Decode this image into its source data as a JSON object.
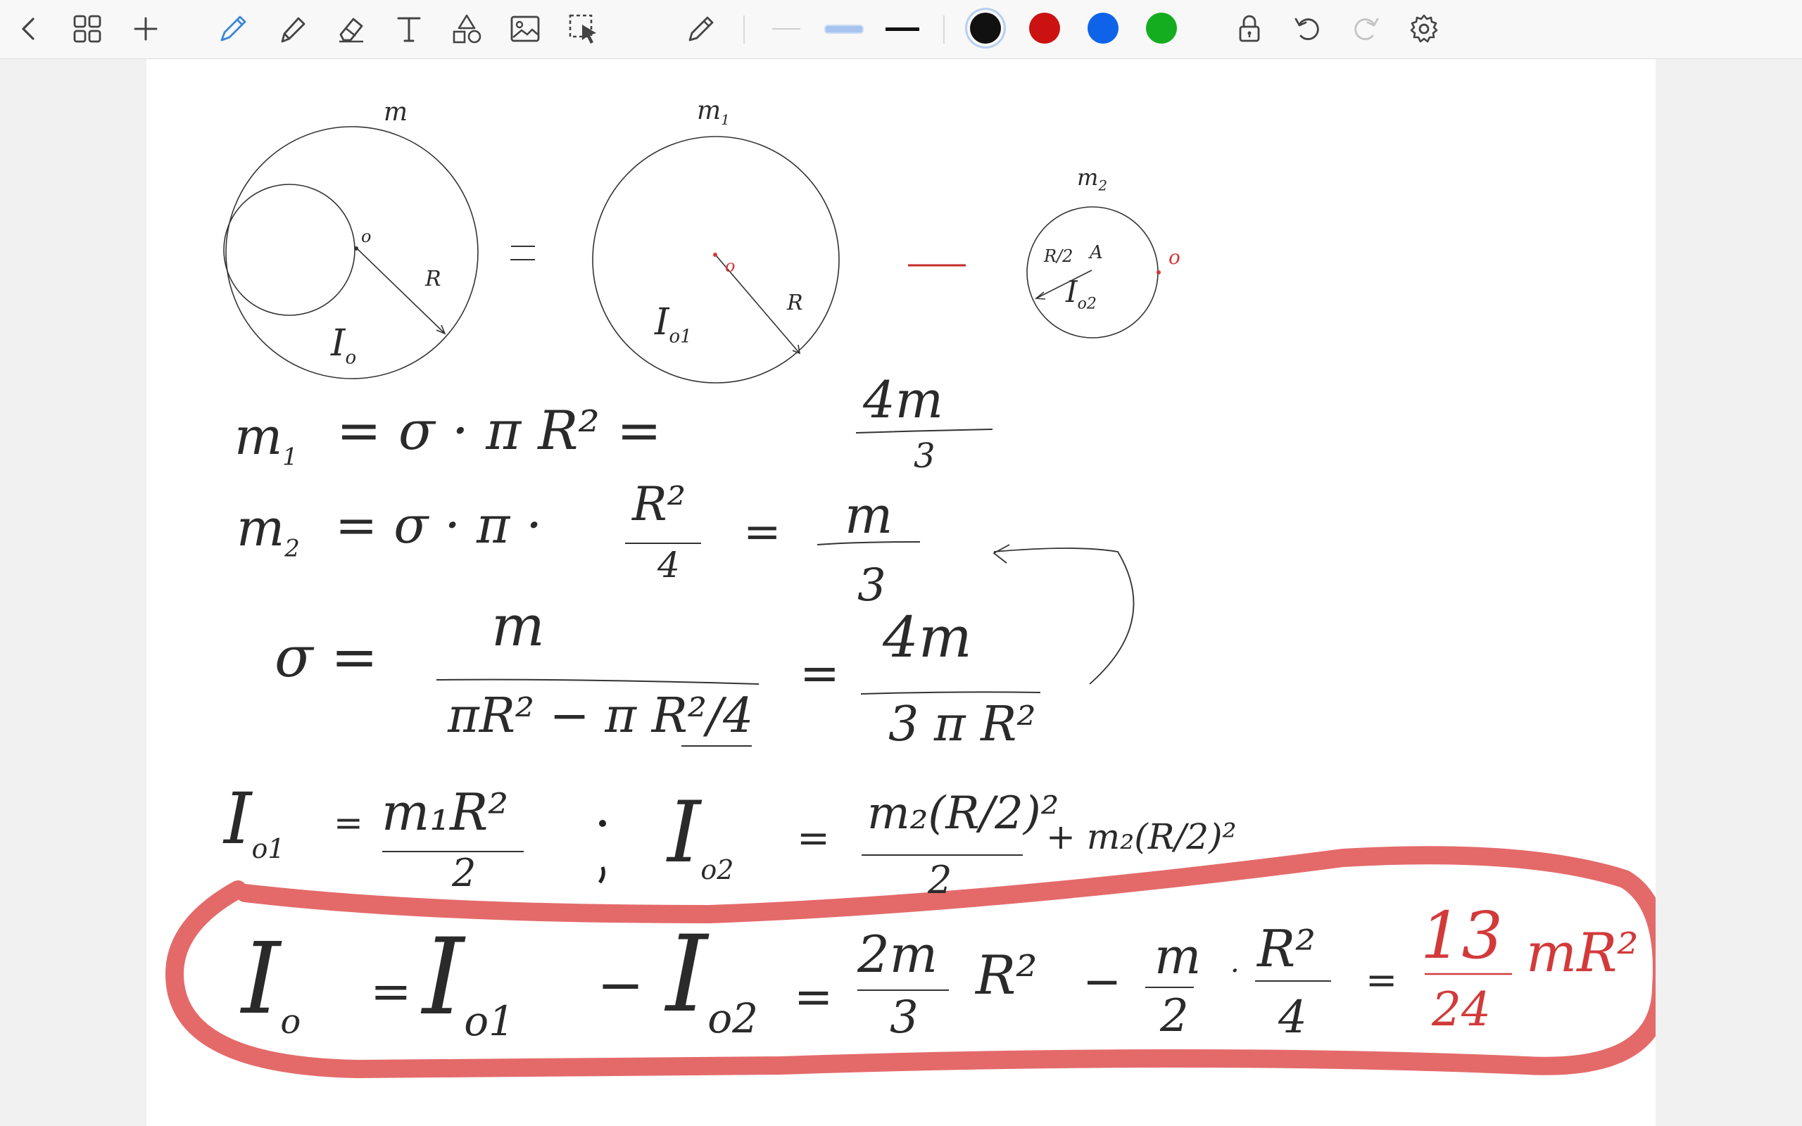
{
  "toolbar": {
    "tools": [
      {
        "id": "back",
        "icon": "chevron-left-icon"
      },
      {
        "id": "pages",
        "icon": "grid-icon"
      },
      {
        "id": "add",
        "icon": "plus-icon"
      },
      {
        "id": "pen",
        "icon": "pen-icon",
        "active": true
      },
      {
        "id": "highlighter",
        "icon": "highlighter-icon"
      },
      {
        "id": "eraser",
        "icon": "eraser-icon"
      },
      {
        "id": "text",
        "icon": "text-icon",
        "glyph": "T"
      },
      {
        "id": "shapes",
        "icon": "shapes-icon"
      },
      {
        "id": "image",
        "icon": "image-icon"
      },
      {
        "id": "lasso",
        "icon": "lasso-select-icon"
      },
      {
        "id": "pencil",
        "icon": "pencil-icon"
      }
    ],
    "stroke_widths": [
      "thin",
      "medium",
      "thick"
    ],
    "selected_width": "medium",
    "colors": [
      "#111111",
      "#cc1111",
      "#0f63e8",
      "#13ad1f"
    ],
    "selected_color": "#111111",
    "accent": "#3a86d9",
    "right_tools": [
      {
        "id": "lock",
        "icon": "lock-icon"
      },
      {
        "id": "undo",
        "icon": "undo-icon"
      },
      {
        "id": "redo",
        "icon": "redo-icon",
        "disabled": true
      },
      {
        "id": "settings",
        "icon": "gear-icon"
      }
    ]
  },
  "notes": {
    "ink_color": "#2a2a2a",
    "red_ink": "#d23a3a",
    "highlight_color": "#e46a6a",
    "diagram": {
      "big_mass": "m",
      "big_center": "o",
      "big_radius": "R",
      "big_inertia": "I",
      "big_inertia_sub": "o",
      "mid_mass": "m",
      "mid_mass_sub": "1",
      "mid_center": "o",
      "mid_radius": "R",
      "mid_inertia": "I",
      "mid_inertia_sub": "o1",
      "small_mass": "m",
      "small_mass_sub": "2",
      "small_radius": "R/2",
      "small_center": "A",
      "small_inertia": "I",
      "small_inertia_sub": "o2",
      "external_point": "o",
      "equals": "=",
      "minus": "—"
    },
    "line1": {
      "lhs": "m",
      "lhs_sub": "1",
      "rhs": "= σ · π R² =",
      "num": "4m",
      "den": "3"
    },
    "line2": {
      "lhs": "m",
      "lhs_sub": "2",
      "rhs": "= σ · π ·",
      "frac_num": "R²",
      "frac_den": "4",
      "eq": "=",
      "num": "m",
      "den": "3"
    },
    "line3": {
      "lhs": "σ =",
      "num1": "m",
      "den1": "πR² − π R²/4",
      "eq": "=",
      "num2": "4m",
      "den2": "3 π R²"
    },
    "line4": {
      "lhs": "I",
      "lhs_sub": "o1",
      "eq": "=",
      "num": "m₁R²",
      "den": "2",
      "sep": ";",
      "lhs2": "I",
      "lhs2_sub": "o2",
      "eq2": "=",
      "num2": "m₂(R/2)²",
      "den2": "2",
      "plus_term": "+ m₂(R/2)²"
    },
    "result": {
      "lhs": "I",
      "lhs_sub": "o",
      "eq1": "=",
      "t1": "I",
      "t1_sub": "o1",
      "minus": "−",
      "t2": "I",
      "t2_sub": "o2",
      "eq2": "=",
      "f1_num": "2m",
      "f1_den": "3",
      "f1_tail": "R²",
      "minus2": "−",
      "f2_num": "m",
      "f2_den": "2",
      "dot": "·",
      "f3_num": "R²",
      "f3_den": "4",
      "eq3": "=",
      "ans_num": "13",
      "ans_den": "24",
      "ans_tail": "mR²"
    }
  }
}
